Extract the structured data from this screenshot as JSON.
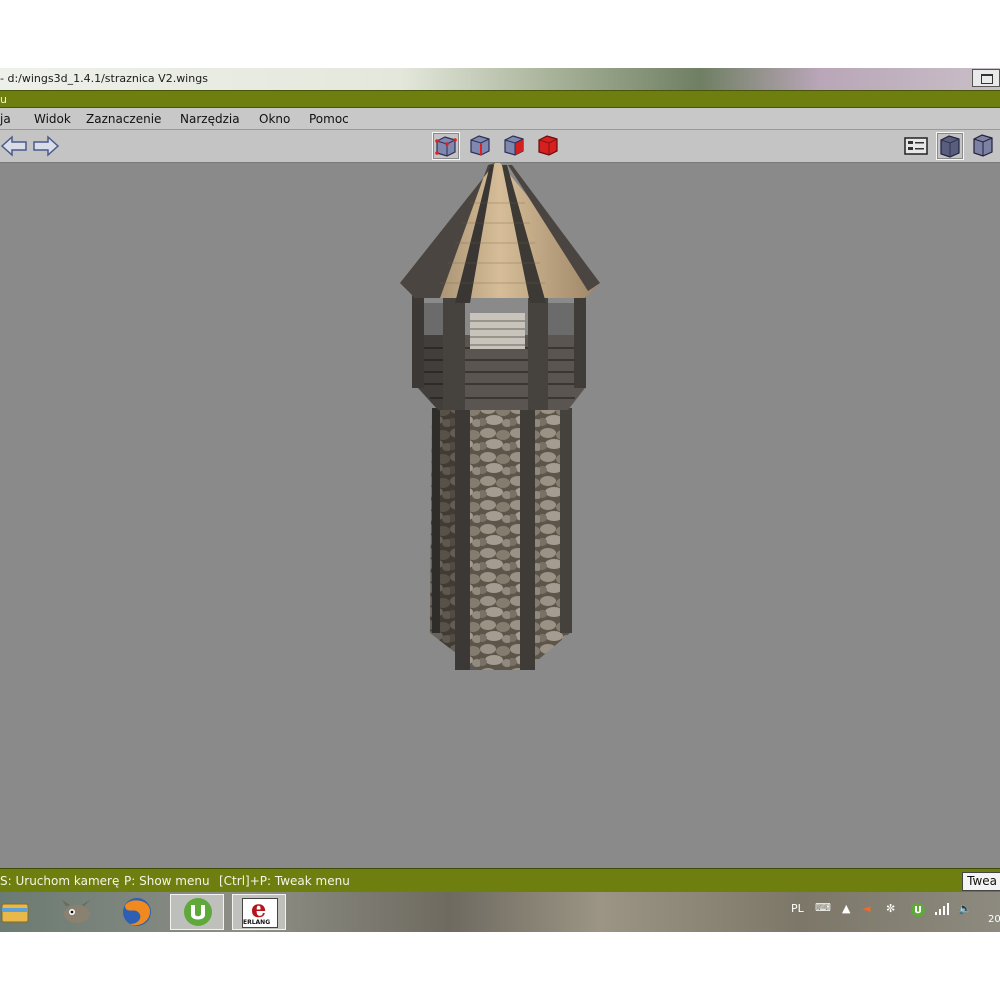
{
  "window": {
    "title": "- d:/wings3d_1.4.1/straznica V2.wings",
    "app_bar_label": "u"
  },
  "menu": [
    {
      "id": "file",
      "label": "ja"
    },
    {
      "id": "view",
      "label": "Widok"
    },
    {
      "id": "select",
      "label": "Zaznaczenie"
    },
    {
      "id": "tools",
      "label": "Narzędzia"
    },
    {
      "id": "window",
      "label": "Okno"
    },
    {
      "id": "help",
      "label": "Pomoc"
    }
  ],
  "toolbar": {
    "nav_icons": [
      "arrow-left-icon",
      "arrow-right-icon"
    ],
    "selection_modes": [
      "vertex-mode-icon",
      "edge-mode-icon",
      "face-mode-icon",
      "body-mode-icon"
    ],
    "right_icons": [
      "view-options-icon",
      "smooth-shaded-icon",
      "wireframe-cube-icon"
    ]
  },
  "status": {
    "hint_camera": "S: Uruchom kamerę",
    "hint_menu": "P: Show menu",
    "hint_tweak": "[Ctrl]+P: Tweak menu",
    "tweak_button": "Twea"
  },
  "taskbar": {
    "apps": [
      "file-explorer-icon",
      "gimp-icon",
      "firefox-icon",
      "utorrent-icon",
      "erlang-icon"
    ],
    "erlang_label": "ERLANG",
    "language": "PL",
    "clock_fragment": "20"
  },
  "colors": {
    "accent_bar": "#6e7f0f",
    "viewport_bg": "#8a8a8a",
    "body_mode_red": "#d62020"
  }
}
